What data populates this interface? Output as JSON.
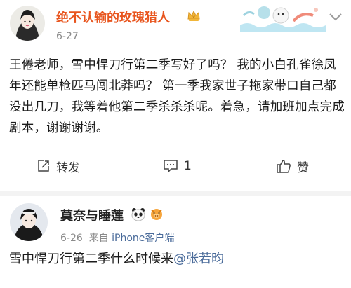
{
  "post": {
    "username": "绝不认输的玫瑰猎人",
    "date": "6-27",
    "text": "王倦老师，雪中悍刀行第二季写好了吗？ 我的小白孔雀徐凤年还能单枪匹马闯北莽吗？ 第一季我家世子拖家带口自己都没出几刀，我等着他第二季杀杀杀呢。着急，请加班加点完成剧本，谢谢谢谢。",
    "actions": {
      "repost_label": "转发",
      "comment_count": "1",
      "like_label": "赞"
    },
    "colors": {
      "username": "#e8551e"
    }
  },
  "comment": {
    "username": "莫奈与睡莲",
    "date": "6-26",
    "source_prefix": "来自",
    "device": "iPhone客户端",
    "text": "雪中悍刀行第二季什么时候来",
    "mention": "@张若昀",
    "colors": {
      "link": "#4a6b9a"
    }
  }
}
